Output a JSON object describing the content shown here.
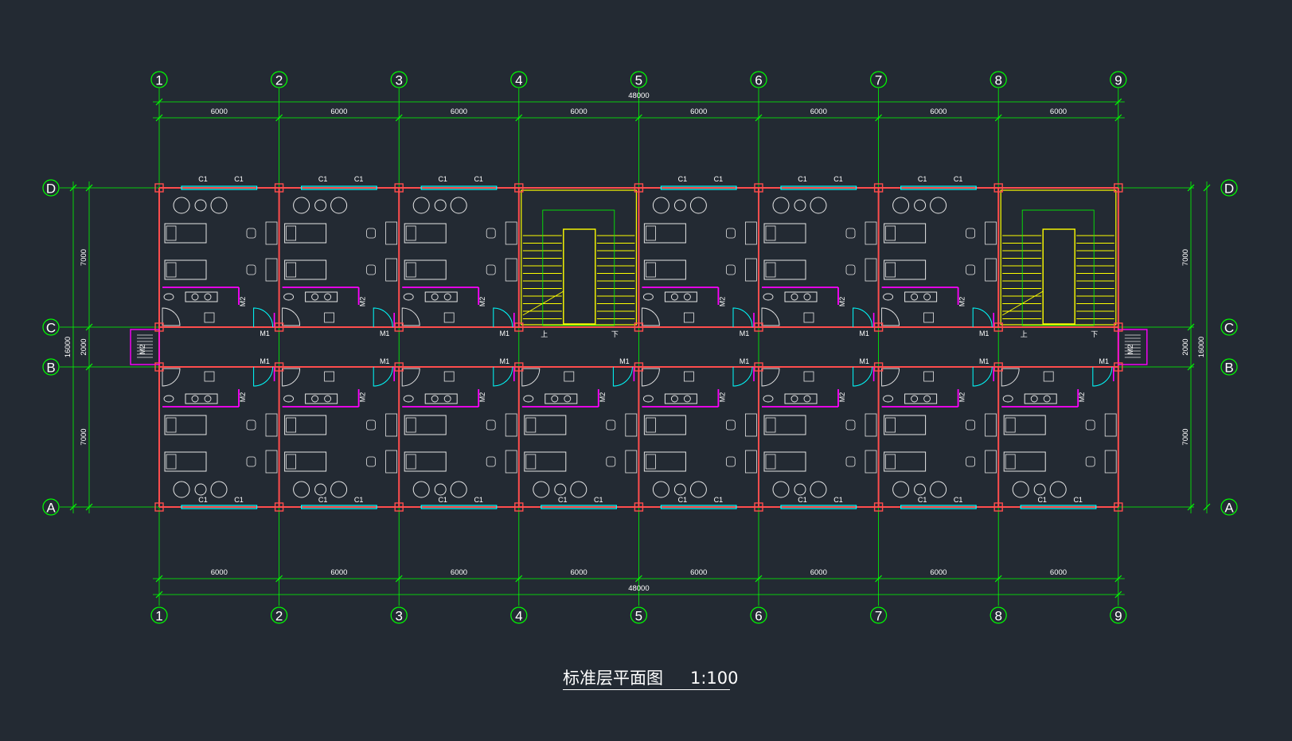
{
  "drawing": {
    "title": "标准层平面图",
    "scale": "1:100"
  },
  "axes": {
    "columns": [
      "1",
      "2",
      "3",
      "4",
      "5",
      "6",
      "7",
      "8",
      "9"
    ],
    "rows": [
      "D",
      "C",
      "B",
      "A"
    ]
  },
  "dimensions": {
    "bay": "6000",
    "total_length": "48000",
    "room_depth": "7000",
    "corridor_width": "2000",
    "total_depth": "16000"
  },
  "labels": {
    "window": "C1",
    "room_door": "M1",
    "bath_door": "M2",
    "stair_up": "上",
    "stair_down": "下"
  },
  "colors": {
    "background": "#232a33",
    "axis_grid": "#00ff00",
    "wall": "#ff4d4d",
    "window": "#00ffff",
    "partition": "#ff00ff",
    "stair": "#ffff00",
    "furniture": "#e6e6e6"
  }
}
